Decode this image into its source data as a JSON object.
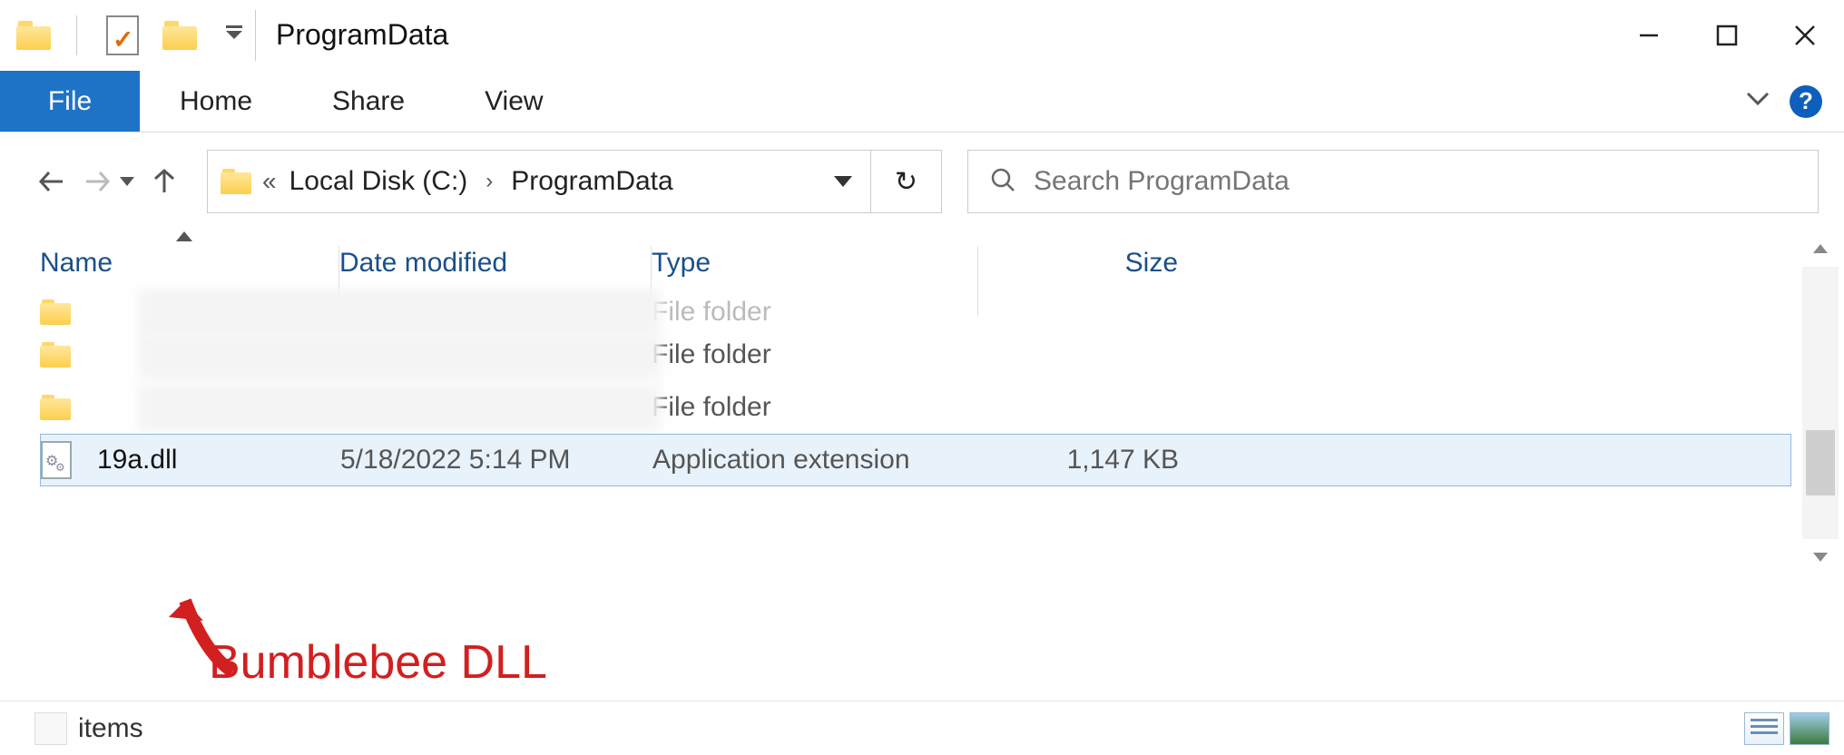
{
  "window": {
    "title": "ProgramData"
  },
  "ribbon": {
    "file_label": "File",
    "tabs": [
      "Home",
      "Share",
      "View"
    ]
  },
  "address": {
    "overflow": "«",
    "crumbs": [
      "Local Disk (C:)",
      "ProgramData"
    ]
  },
  "search": {
    "placeholder": "Search ProgramData"
  },
  "columns": {
    "name": "Name",
    "date": "Date modified",
    "type": "Type",
    "size": "Size"
  },
  "rows": [
    {
      "name": "",
      "date": "",
      "type": "File folder",
      "size": "",
      "icon": "folder",
      "blurred": true,
      "partial": true
    },
    {
      "name": "",
      "date": "",
      "type": "File folder",
      "size": "",
      "icon": "folder",
      "blurred": true
    },
    {
      "name": "",
      "date": "",
      "type": "File folder",
      "size": "",
      "icon": "folder",
      "blurred": true
    },
    {
      "name": "19a.dll",
      "date": "5/18/2022 5:14 PM",
      "type": "Application extension",
      "size": "1,147 KB",
      "icon": "file",
      "selected": true
    }
  ],
  "annotation": {
    "text": "Bumblebee DLL"
  },
  "statusbar": {
    "text": "items"
  }
}
